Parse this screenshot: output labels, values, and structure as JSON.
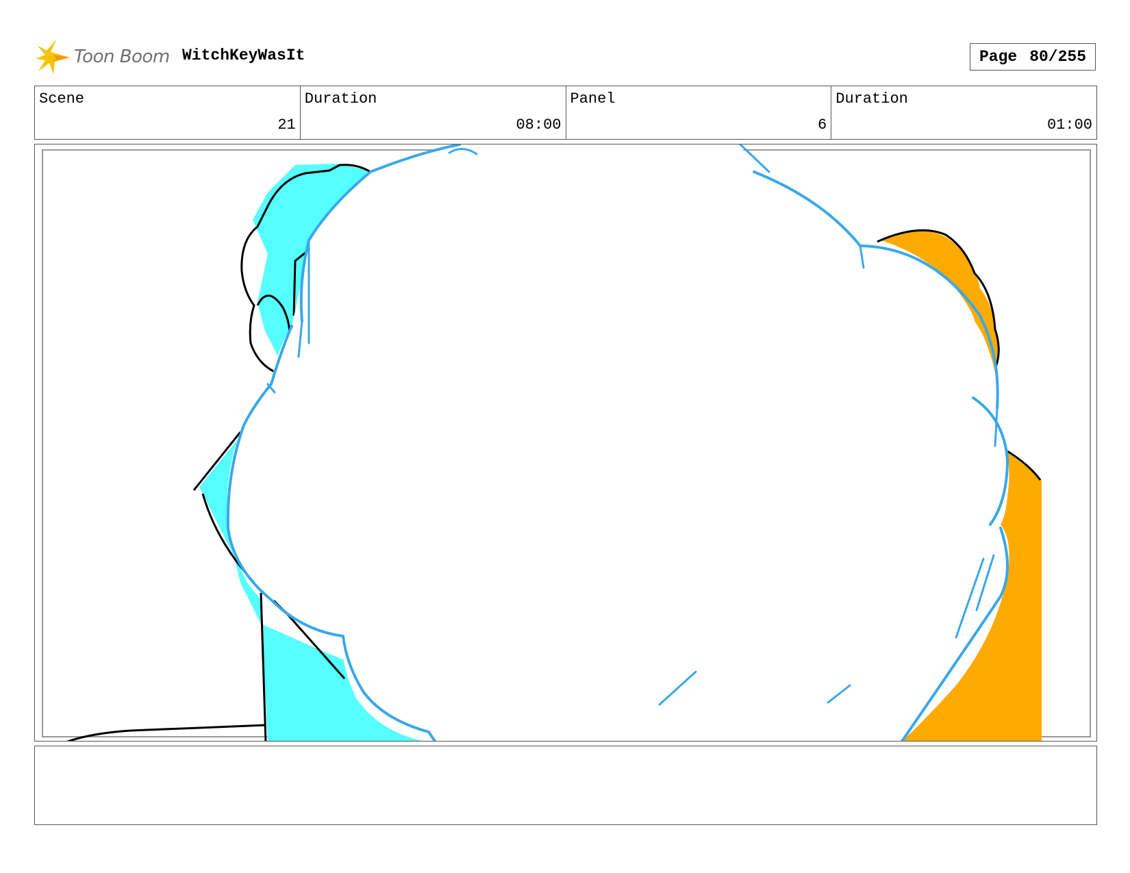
{
  "header": {
    "logo_text": "Toon Boom",
    "project_title": "WitchKeyWasIt",
    "page_label": "Page",
    "page_value": "80/255"
  },
  "info": {
    "scene_label": "Scene",
    "scene_value": "21",
    "scene_duration_label": "Duration",
    "scene_duration_value": "08:00",
    "panel_label": "Panel",
    "panel_value": "6",
    "panel_duration_label": "Duration",
    "panel_duration_value": "01:00"
  },
  "colors": {
    "cyan_fill": "#55ffff",
    "orange_fill": "#ffaa00",
    "cloud_stroke": "#3aa8e8",
    "logo_yellow": "#f5c400"
  },
  "notes": ""
}
